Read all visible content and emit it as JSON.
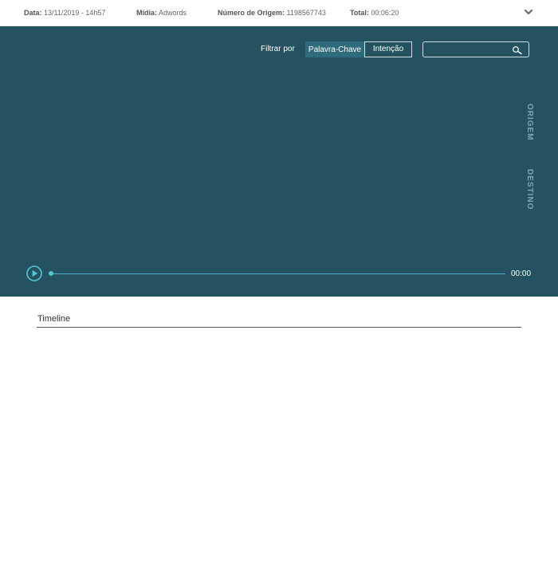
{
  "header": {
    "date": {
      "label": "Data:",
      "value": "13/11/2019 - 14h57"
    },
    "media": {
      "label": "Mídia:",
      "value": "Adwords"
    },
    "origin_number": {
      "label": "Número de Origem:",
      "value": "1198567743"
    },
    "total": {
      "label": "Total:",
      "value": "00:06:20"
    },
    "expand_icon": "chevron-down-icon"
  },
  "player": {
    "filter_label": "Filtrar por",
    "filter_options": [
      "Palavra-Chave",
      "Intenção"
    ],
    "selected_filter": "Palavra-Chave",
    "search": {
      "value": "",
      "placeholder": "",
      "icon": "search-icon"
    },
    "side_labels": [
      "ORIGEM",
      "DESTINO"
    ],
    "play_icon": "play-icon",
    "progress": 0,
    "current_time": "00:00"
  },
  "timeline": {
    "title": "Timeline"
  },
  "colors": {
    "player_background": "#245260",
    "accent": "#53c6d6",
    "selected_filter_bg": "#2f6b7a",
    "side_label": "#7fa6b2"
  }
}
